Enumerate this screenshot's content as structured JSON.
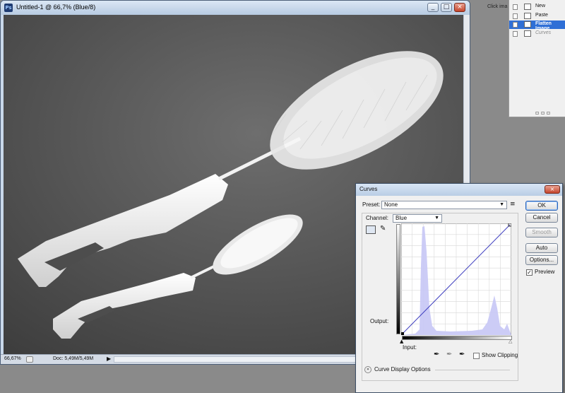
{
  "document": {
    "title": "Untitled-1 @ 66,7% (Blue/8)",
    "ps_badge": "Ps",
    "status_zoom": "66,67%",
    "status_doc_size": "Doc: 5,49M/5,49M",
    "status_arrow": "▶"
  },
  "window_buttons": {
    "minimize": "_",
    "maximize": "□",
    "close": "×"
  },
  "history": {
    "hint_text": "Click ima",
    "items": [
      {
        "label": "New"
      },
      {
        "label": "Paste"
      },
      {
        "label": "Flatten Image"
      },
      {
        "label": "Curves"
      }
    ],
    "footer_icons": "▫ ▫ ▫"
  },
  "curves": {
    "title": "Curves",
    "close": "×",
    "preset_label": "Preset:",
    "preset_value": "None",
    "channel_label": "Channel:",
    "channel_value": "Blue",
    "output_label": "Output:",
    "input_label": "Input:",
    "show_clipping_label": "Show Clipping",
    "curve_display_label": "Curve Display Options",
    "buttons": {
      "ok": "OK",
      "cancel": "Cancel",
      "smooth": "Smooth",
      "auto": "Auto",
      "options": "Options..."
    },
    "preview_label": "Preview",
    "preview_checked": "✓",
    "accent_color": "#2f6fd6",
    "histogram_color": "#c9c9f5",
    "curve_color": "#4040c0"
  }
}
